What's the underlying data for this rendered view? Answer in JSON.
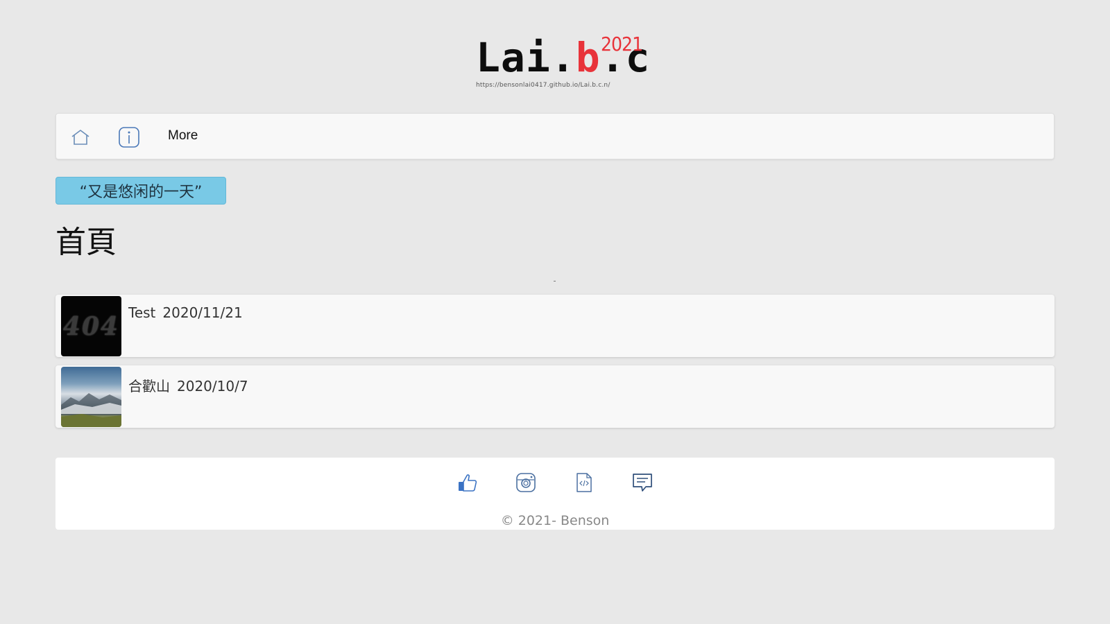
{
  "logo": {
    "prefix": "Lai.",
    "accent": "b",
    "suffix": ".c",
    "year": "2021",
    "url": "https://bensonlai0417.github.io/Lai.b.c.n/"
  },
  "nav": {
    "home_icon": "home-icon",
    "info_icon": "info-icon",
    "more_label": "More"
  },
  "motto": "“又是悠闲的一天”",
  "page_title": "首頁",
  "posts": [
    {
      "title": "Test",
      "date": "2020/11/21",
      "thumb_text": "404"
    },
    {
      "title": "合歡山",
      "date": "2020/10/7",
      "thumb_text": ""
    }
  ],
  "footer": {
    "icons": [
      "thumbs-up-icon",
      "instagram-icon",
      "code-file-icon",
      "comment-icon"
    ],
    "copyright": "© 2021- Benson"
  },
  "colors": {
    "background": "#e8e8e8",
    "accent_red": "#e8333a",
    "motto_bg": "#79c9e6",
    "icon_blue": "#4a78b8"
  }
}
